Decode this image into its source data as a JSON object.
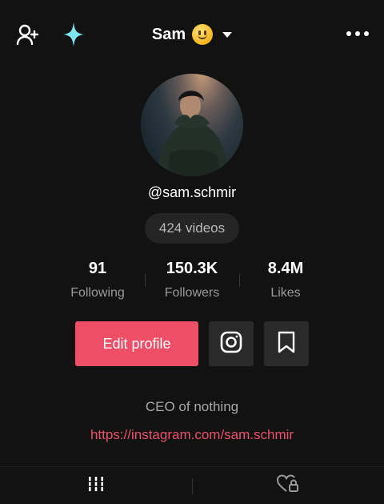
{
  "header": {
    "title": "Sam",
    "icons": [
      "add-user-icon",
      "sparkle-icon",
      "smile-emoji-icon",
      "caret-down-icon",
      "more-icon"
    ]
  },
  "profile": {
    "username": "@sam.schmir",
    "videos": "424 videos",
    "bio": "CEO of nothing",
    "link": "https://instagram.com/sam.schmir"
  },
  "stats": {
    "following": {
      "value": "91",
      "label": "Following"
    },
    "followers": {
      "value": "150.3K",
      "label": "Followers"
    },
    "likes": {
      "value": "8.4M",
      "label": "Likes"
    }
  },
  "actions": {
    "edit_profile": "Edit profile",
    "icons": [
      "instagram-icon",
      "bookmark-icon"
    ]
  },
  "tabs": {
    "icons": [
      "videos-grid-icon",
      "liked-locked-icon"
    ]
  },
  "colors": {
    "background": "#121212",
    "accent": "#ef4e67",
    "link": "#e8536a",
    "sparkle": "#7fe4ef"
  }
}
